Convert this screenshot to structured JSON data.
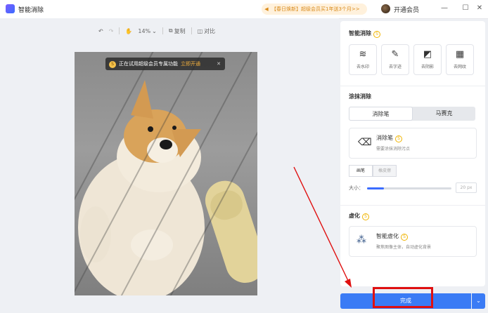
{
  "window": {
    "title": "智能消除",
    "promo_text": "【春日焕新】超级会员买1年送3个月>>",
    "vip_label": "开通会员",
    "min_glyph": "—",
    "max_glyph": "☐",
    "close_glyph": "✕"
  },
  "toolbar": {
    "undo_glyph": "↶",
    "redo_glyph": "↷",
    "hand_glyph": "✋",
    "zoom": "14%",
    "zoom_arrow": "⌄",
    "copy_label": "复制",
    "compare_label": "对比"
  },
  "canvas": {
    "trial_coin": "S",
    "trial_text": "正在试用超级会员专属功能",
    "trial_open": "立即开通",
    "trial_close": "✕"
  },
  "smart_erase": {
    "title": "智能消除",
    "help": "S",
    "tools": [
      {
        "label": "去水印",
        "icon": "watermark-icon",
        "glyph": "≋"
      },
      {
        "label": "去字迹",
        "icon": "handwriting-icon",
        "glyph": "✎"
      },
      {
        "label": "去阴影",
        "icon": "shadow-icon",
        "glyph": "◩"
      },
      {
        "label": "去网纹",
        "icon": "moire-icon",
        "glyph": "▦"
      }
    ]
  },
  "paint_erase": {
    "title": "涂抹消除",
    "tabs": [
      "消除笔",
      "马赛克"
    ],
    "brush_name": "消除笔",
    "brush_help": "S",
    "brush_desc": "需要涂抹消除污点",
    "brush_glyph": "⌫",
    "modes": [
      "画笔",
      "橡皮擦"
    ],
    "size_label": "大小：",
    "size_value": "20",
    "size_unit": "px",
    "size_fraction": 0.2
  },
  "blur": {
    "title": "虚化",
    "help": "S",
    "card_name": "智能虚化",
    "card_help": "S",
    "card_desc": "聚焦图像主体，自动虚化背景",
    "card_glyph": "⁂"
  },
  "footer": {
    "done_label": "完成",
    "dropdown_glyph": "⌄"
  },
  "colors": {
    "accent": "#3a7bf5",
    "highlight": "#e01010",
    "promo": "#d98a1a"
  }
}
